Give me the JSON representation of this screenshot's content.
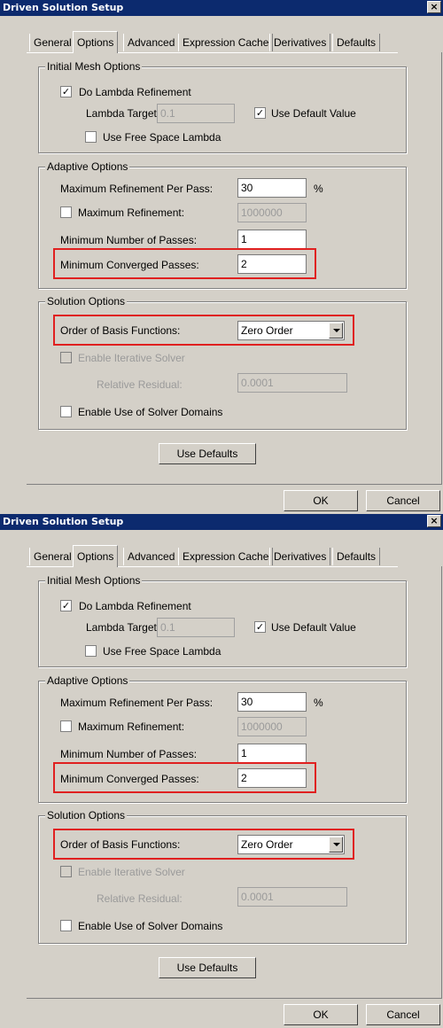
{
  "dialogs": [
    {
      "title": "Driven Solution Setup",
      "close_glyph": "×",
      "tabs": [
        "General",
        "Options",
        "Advanced",
        "Expression Cache",
        "Derivatives",
        "Defaults"
      ],
      "active_tab": "Options",
      "initial_mesh": {
        "legend": "Initial Mesh Options",
        "do_lambda_refinement": {
          "label": "Do Lambda Refinement",
          "checked": true
        },
        "lambda_target": {
          "label": "Lambda Target:",
          "value": "0.1"
        },
        "use_default_value": {
          "label": "Use Default Value",
          "checked": true
        },
        "use_free_space_lambda": {
          "label": "Use Free Space Lambda",
          "checked": false
        }
      },
      "adaptive": {
        "legend": "Adaptive Options",
        "max_refinement_per_pass": {
          "label": "Maximum Refinement Per Pass:",
          "value": "30",
          "unit": "%"
        },
        "max_refinement": {
          "label": "Maximum Refinement:",
          "value": "1000000",
          "checked": false
        },
        "min_number_of_passes": {
          "label": "Minimum Number of Passes:",
          "value": "1"
        },
        "min_converged_passes": {
          "label": "Minimum Converged Passes:",
          "value": "2"
        }
      },
      "solution": {
        "legend": "Solution Options",
        "order_of_basis": {
          "label": "Order of Basis Functions:",
          "value": "Zero Order"
        },
        "enable_iterative_solver": {
          "label": "Enable Iterative Solver",
          "checked": false
        },
        "relative_residual": {
          "label": "Relative Residual:",
          "value": "0.0001"
        },
        "enable_solver_domains": {
          "label": "Enable Use of Solver Domains",
          "checked": false
        }
      },
      "use_defaults_label": "Use Defaults",
      "ok_label": "OK",
      "cancel_label": "Cancel",
      "check_glyph": "✓",
      "highlight_color": "#e02020"
    },
    {
      "title": "Driven Solution Setup",
      "close_glyph": "×",
      "tabs": [
        "General",
        "Options",
        "Advanced",
        "Expression Cache",
        "Derivatives",
        "Defaults"
      ],
      "active_tab": "Options",
      "initial_mesh": {
        "legend": "Initial Mesh Options",
        "do_lambda_refinement": {
          "label": "Do Lambda Refinement",
          "checked": true
        },
        "lambda_target": {
          "label": "Lambda Target:",
          "value": "0.1"
        },
        "use_default_value": {
          "label": "Use Default Value",
          "checked": true
        },
        "use_free_space_lambda": {
          "label": "Use Free Space Lambda",
          "checked": false
        }
      },
      "adaptive": {
        "legend": "Adaptive Options",
        "max_refinement_per_pass": {
          "label": "Maximum Refinement Per Pass:",
          "value": "30",
          "unit": "%"
        },
        "max_refinement": {
          "label": "Maximum Refinement:",
          "value": "1000000",
          "checked": false
        },
        "min_number_of_passes": {
          "label": "Minimum Number of Passes:",
          "value": "1"
        },
        "min_converged_passes": {
          "label": "Minimum Converged Passes:",
          "value": "2"
        }
      },
      "solution": {
        "legend": "Solution Options",
        "order_of_basis": {
          "label": "Order of Basis Functions:",
          "value": "Zero Order"
        },
        "enable_iterative_solver": {
          "label": "Enable Iterative Solver",
          "checked": false
        },
        "relative_residual": {
          "label": "Relative Residual:",
          "value": "0.0001"
        },
        "enable_solver_domains": {
          "label": "Enable Use of Solver Domains",
          "checked": false
        }
      },
      "use_defaults_label": "Use Defaults",
      "ok_label": "OK",
      "cancel_label": "Cancel",
      "check_glyph": "✓",
      "highlight_color": "#e02020"
    }
  ]
}
